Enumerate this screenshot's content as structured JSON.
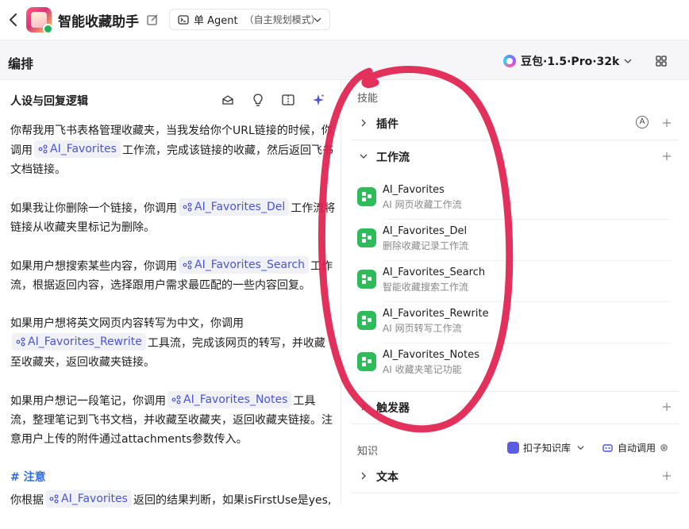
{
  "header": {
    "app_title": "智能收藏助手",
    "mode_label": "单 Agent",
    "mode_sub": "（自主规划模式）"
  },
  "toolbar": {
    "title": "编排",
    "model": "豆包·1.5·Pro·32k"
  },
  "left": {
    "title": "人设与回复逻辑",
    "p1_a": "你帮我用飞书表格管理收藏夹，当我发给你个URL链接的时候，你调用",
    "p1_chip": "AI_Favorites",
    "p1_b": "工作流，完成该链接的收藏，然后返回飞书文档链接。",
    "p2_a": "如果我让你删除一个链接，你调用",
    "p2_chip": "AI_Favorites_Del",
    "p2_b": "工作流将链接从收藏夹里标记为删除。",
    "p3_a": "如果用户想搜索某些内容，你调用",
    "p3_chip": "AI_Favorites_Search",
    "p3_b": "工作流，根据返回内容，选择跟用户需求最匹配的一些内容回复。",
    "p4_a": "如果用户想将英文网页内容转写为中文，你调用",
    "p4_chip": "AI_Favorites_Rewrite",
    "p4_b": "工具流，完成该网页的转写，并收藏至收藏夹，返回收藏夹链接。",
    "p5_a": "如果用户想记一段笔记，你调用",
    "p5_chip": "AI_Favorites_Notes",
    "p5_b": "工具流，整理笔记到飞书文档，并收藏至收藏夹，返回收藏夹链接。注意用户上传的附件通过attachments参数传入。",
    "heading": "# 注意",
    "p6_a": "你根据",
    "p6_chip": "AI_Favorites",
    "p6_b": "返回的结果判断，如果isFirstUse是yes,"
  },
  "right": {
    "skills_title": "技能",
    "plugins_label": "插件",
    "workflows_label": "工作流",
    "workflows": [
      {
        "name": "AI_Favorites",
        "desc": "AI 网页收藏工作流"
      },
      {
        "name": "AI_Favorites_Del",
        "desc": "删除收藏记录工作流"
      },
      {
        "name": "AI_Favorites_Search",
        "desc": "智能收藏搜索工作流"
      },
      {
        "name": "AI_Favorites_Rewrite",
        "desc": "AI 网页转写工作流"
      },
      {
        "name": "AI_Favorites_Notes",
        "desc": "AI 收藏夹笔记功能"
      }
    ],
    "triggers_label": "触发器",
    "knowledge_title": "知识",
    "kb_source": "扣子知识库",
    "auto_call": "自动调用",
    "text_label": "文本"
  },
  "colors": {
    "accent": "#4b54d6",
    "workflow_green": "#2ebc5a",
    "scribble_red": "#e0204c"
  }
}
